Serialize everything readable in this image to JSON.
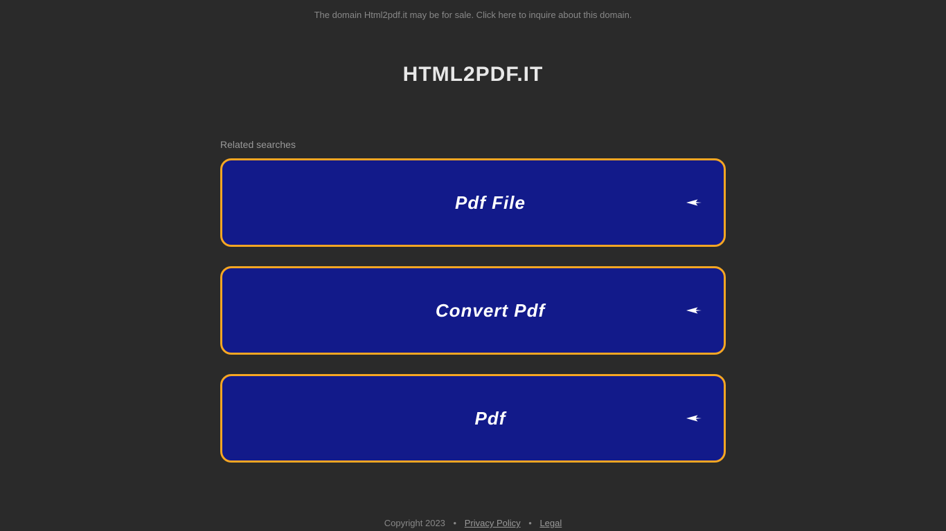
{
  "topBanner": "The domain Html2pdf.it may be for sale. Click here to inquire about this domain.",
  "domainTitle": "HTML2PDF.IT",
  "relatedLabel": "Related searches",
  "searches": {
    "item0": "Pdf File",
    "item1": "Convert Pdf",
    "item2": "Pdf"
  },
  "footer": {
    "copyright": "Copyright 2023",
    "sep": "•",
    "privacy": "Privacy Policy",
    "legal": "Legal"
  }
}
